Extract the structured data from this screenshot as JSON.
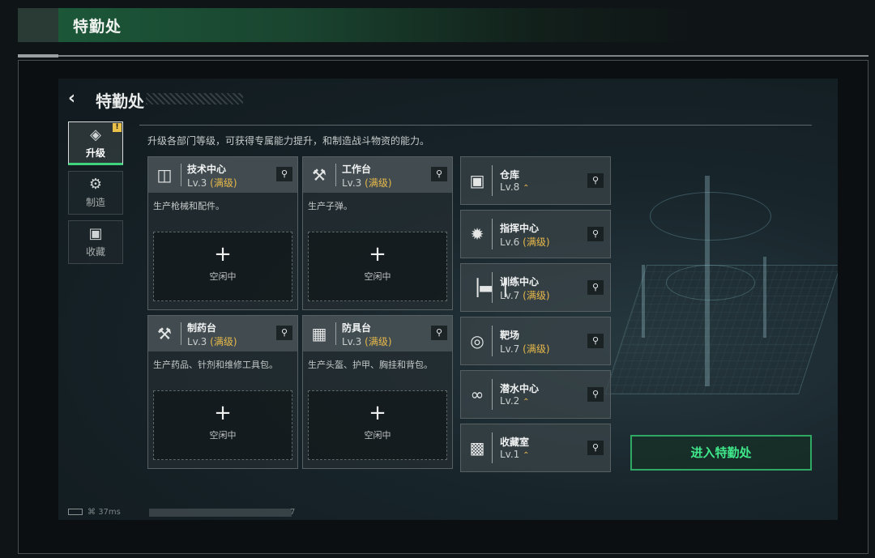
{
  "header": {
    "title": "特勤处"
  },
  "screen": {
    "title": "特勤处",
    "description": "升级各部门等级，可获得专属能力提升，和制造战斗物资的能力。",
    "enter_button": "进入特勤处"
  },
  "tabs": [
    {
      "label": "升级",
      "icon": "upgrade-icon",
      "active": true,
      "alert": "!"
    },
    {
      "label": "制造",
      "icon": "gear-icon",
      "active": false
    },
    {
      "label": "收藏",
      "icon": "collection-icon",
      "active": false
    }
  ],
  "workstations": [
    {
      "name": "技术中心",
      "level": "Lv.3",
      "status": "(满级)",
      "icon": "tech-center-icon",
      "desc": "生产枪械和配件。",
      "slot_plus": "+",
      "slot_state": "空闲中"
    },
    {
      "name": "工作台",
      "level": "Lv.3",
      "status": "(满级)",
      "icon": "workbench-icon",
      "desc": "生产子弹。",
      "slot_plus": "+",
      "slot_state": "空闲中"
    },
    {
      "name": "制药台",
      "level": "Lv.3",
      "status": "(满级)",
      "icon": "pharmacy-icon",
      "desc": "生产药品、针剂和维修工具包。",
      "slot_plus": "+",
      "slot_state": "空闲中"
    },
    {
      "name": "防具台",
      "level": "Lv.3",
      "status": "(满级)",
      "icon": "armor-bench-icon",
      "desc": "生产头盔、护甲、胸挂和背包。",
      "slot_plus": "+",
      "slot_state": "空闲中"
    }
  ],
  "buildings": [
    {
      "name": "仓库",
      "level": "Lv.8",
      "status": "",
      "upgradable": true,
      "icon": "warehouse-icon"
    },
    {
      "name": "指挥中心",
      "level": "Lv.6",
      "status": "(满级)",
      "upgradable": false,
      "icon": "command-center-icon"
    },
    {
      "name": "训练中心",
      "level": "Lv.7",
      "status": "(满级)",
      "upgradable": false,
      "icon": "training-dumbbell-icon"
    },
    {
      "name": "靶场",
      "level": "Lv.7",
      "status": "(满级)",
      "upgradable": false,
      "icon": "target-icon"
    },
    {
      "name": "潜水中心",
      "level": "Lv.2",
      "status": "",
      "upgradable": true,
      "icon": "diving-goggles-icon"
    },
    {
      "name": "收藏室",
      "level": "Lv.1",
      "status": "",
      "upgradable": true,
      "icon": "collection-room-icon"
    }
  ],
  "status_bar": {
    "ping": "37ms",
    "tail": "7"
  },
  "colors": {
    "accent_green": "#3fe88a",
    "max_gold": "#e8b94a",
    "banner_green": "#1c5a3a"
  },
  "icons": {
    "back": "back-arrow-icon",
    "magnifier": "magnifier-icon",
    "wifi": "wifi-icon",
    "battery": "battery-icon"
  }
}
